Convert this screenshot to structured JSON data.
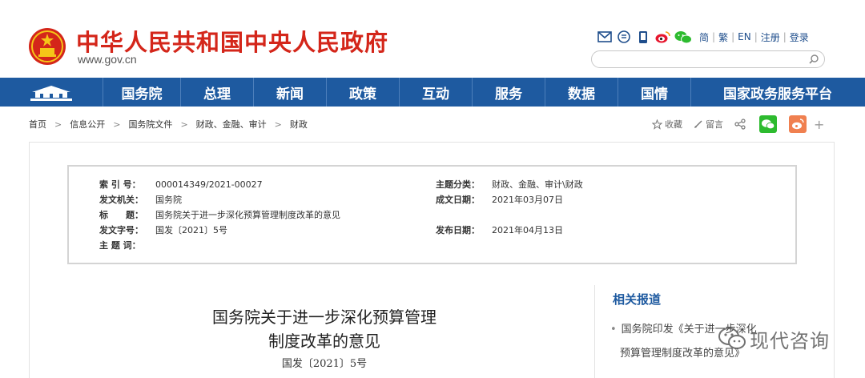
{
  "header": {
    "site_title": "中华人民共和国中央人民政府",
    "domain": "www.gov.cn",
    "languages": [
      "简",
      "繁",
      "EN",
      "注册",
      "登录"
    ],
    "search": {
      "value": "",
      "placeholder": ""
    }
  },
  "nav": {
    "items": [
      {
        "label": "国务院"
      },
      {
        "label": "总理"
      },
      {
        "label": "新闻"
      },
      {
        "label": "政策"
      },
      {
        "label": "互动"
      },
      {
        "label": "服务"
      },
      {
        "label": "数据"
      },
      {
        "label": "国情"
      },
      {
        "label": "国家政务服务平台"
      }
    ]
  },
  "breadcrumb": [
    "首页",
    "信息公开",
    "国务院文件",
    "财政、金融、审计",
    "财政"
  ],
  "actions": {
    "favorite": "收藏",
    "comment": "留言",
    "more": "+"
  },
  "meta": {
    "index_label": "索 引 号：",
    "index_value": "000014349/2021-00027",
    "topic_label": "主题分类：",
    "topic_value": "财政、金融、审计\\财政",
    "issuer_label": "发文机关：",
    "issuer_value": "国务院",
    "created_label": "成文日期：",
    "created_value": "2021年03月07日",
    "title_label": "标　　题：",
    "title_value": "国务院关于进一步深化预算管理制度改革的意见",
    "doc_no_label": "发文字号：",
    "doc_no_value": "国发〔2021〕5号",
    "published_label": "发布日期：",
    "published_value": "2021年04月13日",
    "keywords_label": "主 题 词：",
    "keywords_value": ""
  },
  "document": {
    "title_line1": "国务院关于进一步深化预算管理",
    "title_line2": "制度改革的意见",
    "number": "国发〔2021〕5号"
  },
  "related": {
    "heading": "相关报道",
    "item_line1": "国务院印发《关于进一步深化",
    "item_line2": "预算管理制度改革的意见》"
  },
  "watermark": {
    "text": "现代咨询"
  },
  "colors": {
    "brand_red": "#d4261a",
    "nav_blue": "#1e5aa0",
    "wechat_green": "#2dbb2f",
    "weibo_orange": "#f08050"
  }
}
